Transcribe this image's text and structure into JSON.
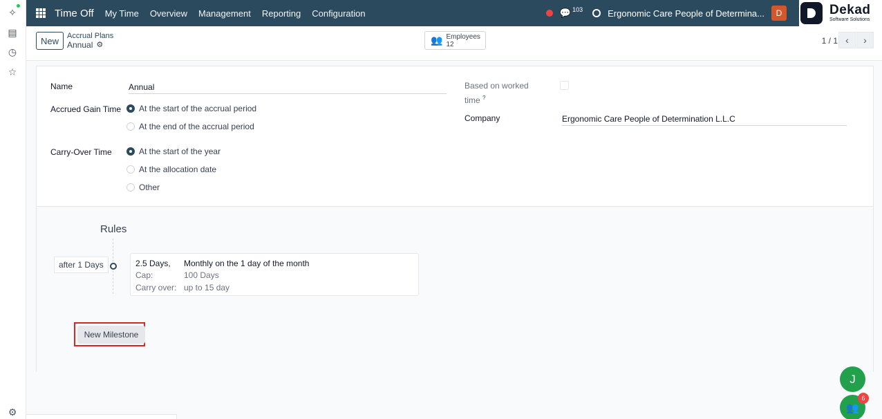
{
  "navbar": {
    "app_title": "Time Off",
    "menu": [
      "My Time",
      "Overview",
      "Management",
      "Reporting",
      "Configuration"
    ],
    "chat_count": "103",
    "company": "Ergonomic Care People of Determina...",
    "user_initial": "D",
    "bg_color": "#2c4a5e"
  },
  "logo": {
    "title": "Dekad",
    "subtitle": "Software Solutions"
  },
  "control_panel": {
    "new_label": "New",
    "breadcrumb_parent": "Accrual Plans",
    "breadcrumb_current": "Annual",
    "employees_label": "Employees",
    "employees_count": "12",
    "pager": "1 / 1"
  },
  "form": {
    "name_label": "Name",
    "name_value": "Annual",
    "accrued_label": "Accrued Gain Time",
    "accrued_options": [
      "At the start of the accrual period",
      "At the end of the accrual period"
    ],
    "accrued_selected": 0,
    "carryover_label": "Carry-Over Time",
    "carryover_options": [
      "At the start of the year",
      "At the allocation date",
      "Other"
    ],
    "carryover_selected": 0,
    "worked_time_label_1": "Based on worked",
    "worked_time_label_2": "time",
    "worked_time_help": "?",
    "worked_time_checked": false,
    "company_label": "Company",
    "company_value": "Ergonomic Care People of Determination L.L.C"
  },
  "rules": {
    "title": "Rules",
    "milestone": {
      "after": "after 1 Days",
      "amount": "2.5 Days,",
      "frequency": "Monthly on the 1 day of the month",
      "cap_label": "Cap:",
      "cap_value": "100 Days",
      "carry_label": "Carry over:",
      "carry_value": "up to 15 day"
    },
    "new_milestone_label": "New Milestone"
  },
  "floating": {
    "j_initial": "J",
    "badge_count": "6"
  },
  "colors": {
    "accent": "#2c4a5e",
    "highlight": "#dc2626",
    "fab": "#22a04b"
  }
}
